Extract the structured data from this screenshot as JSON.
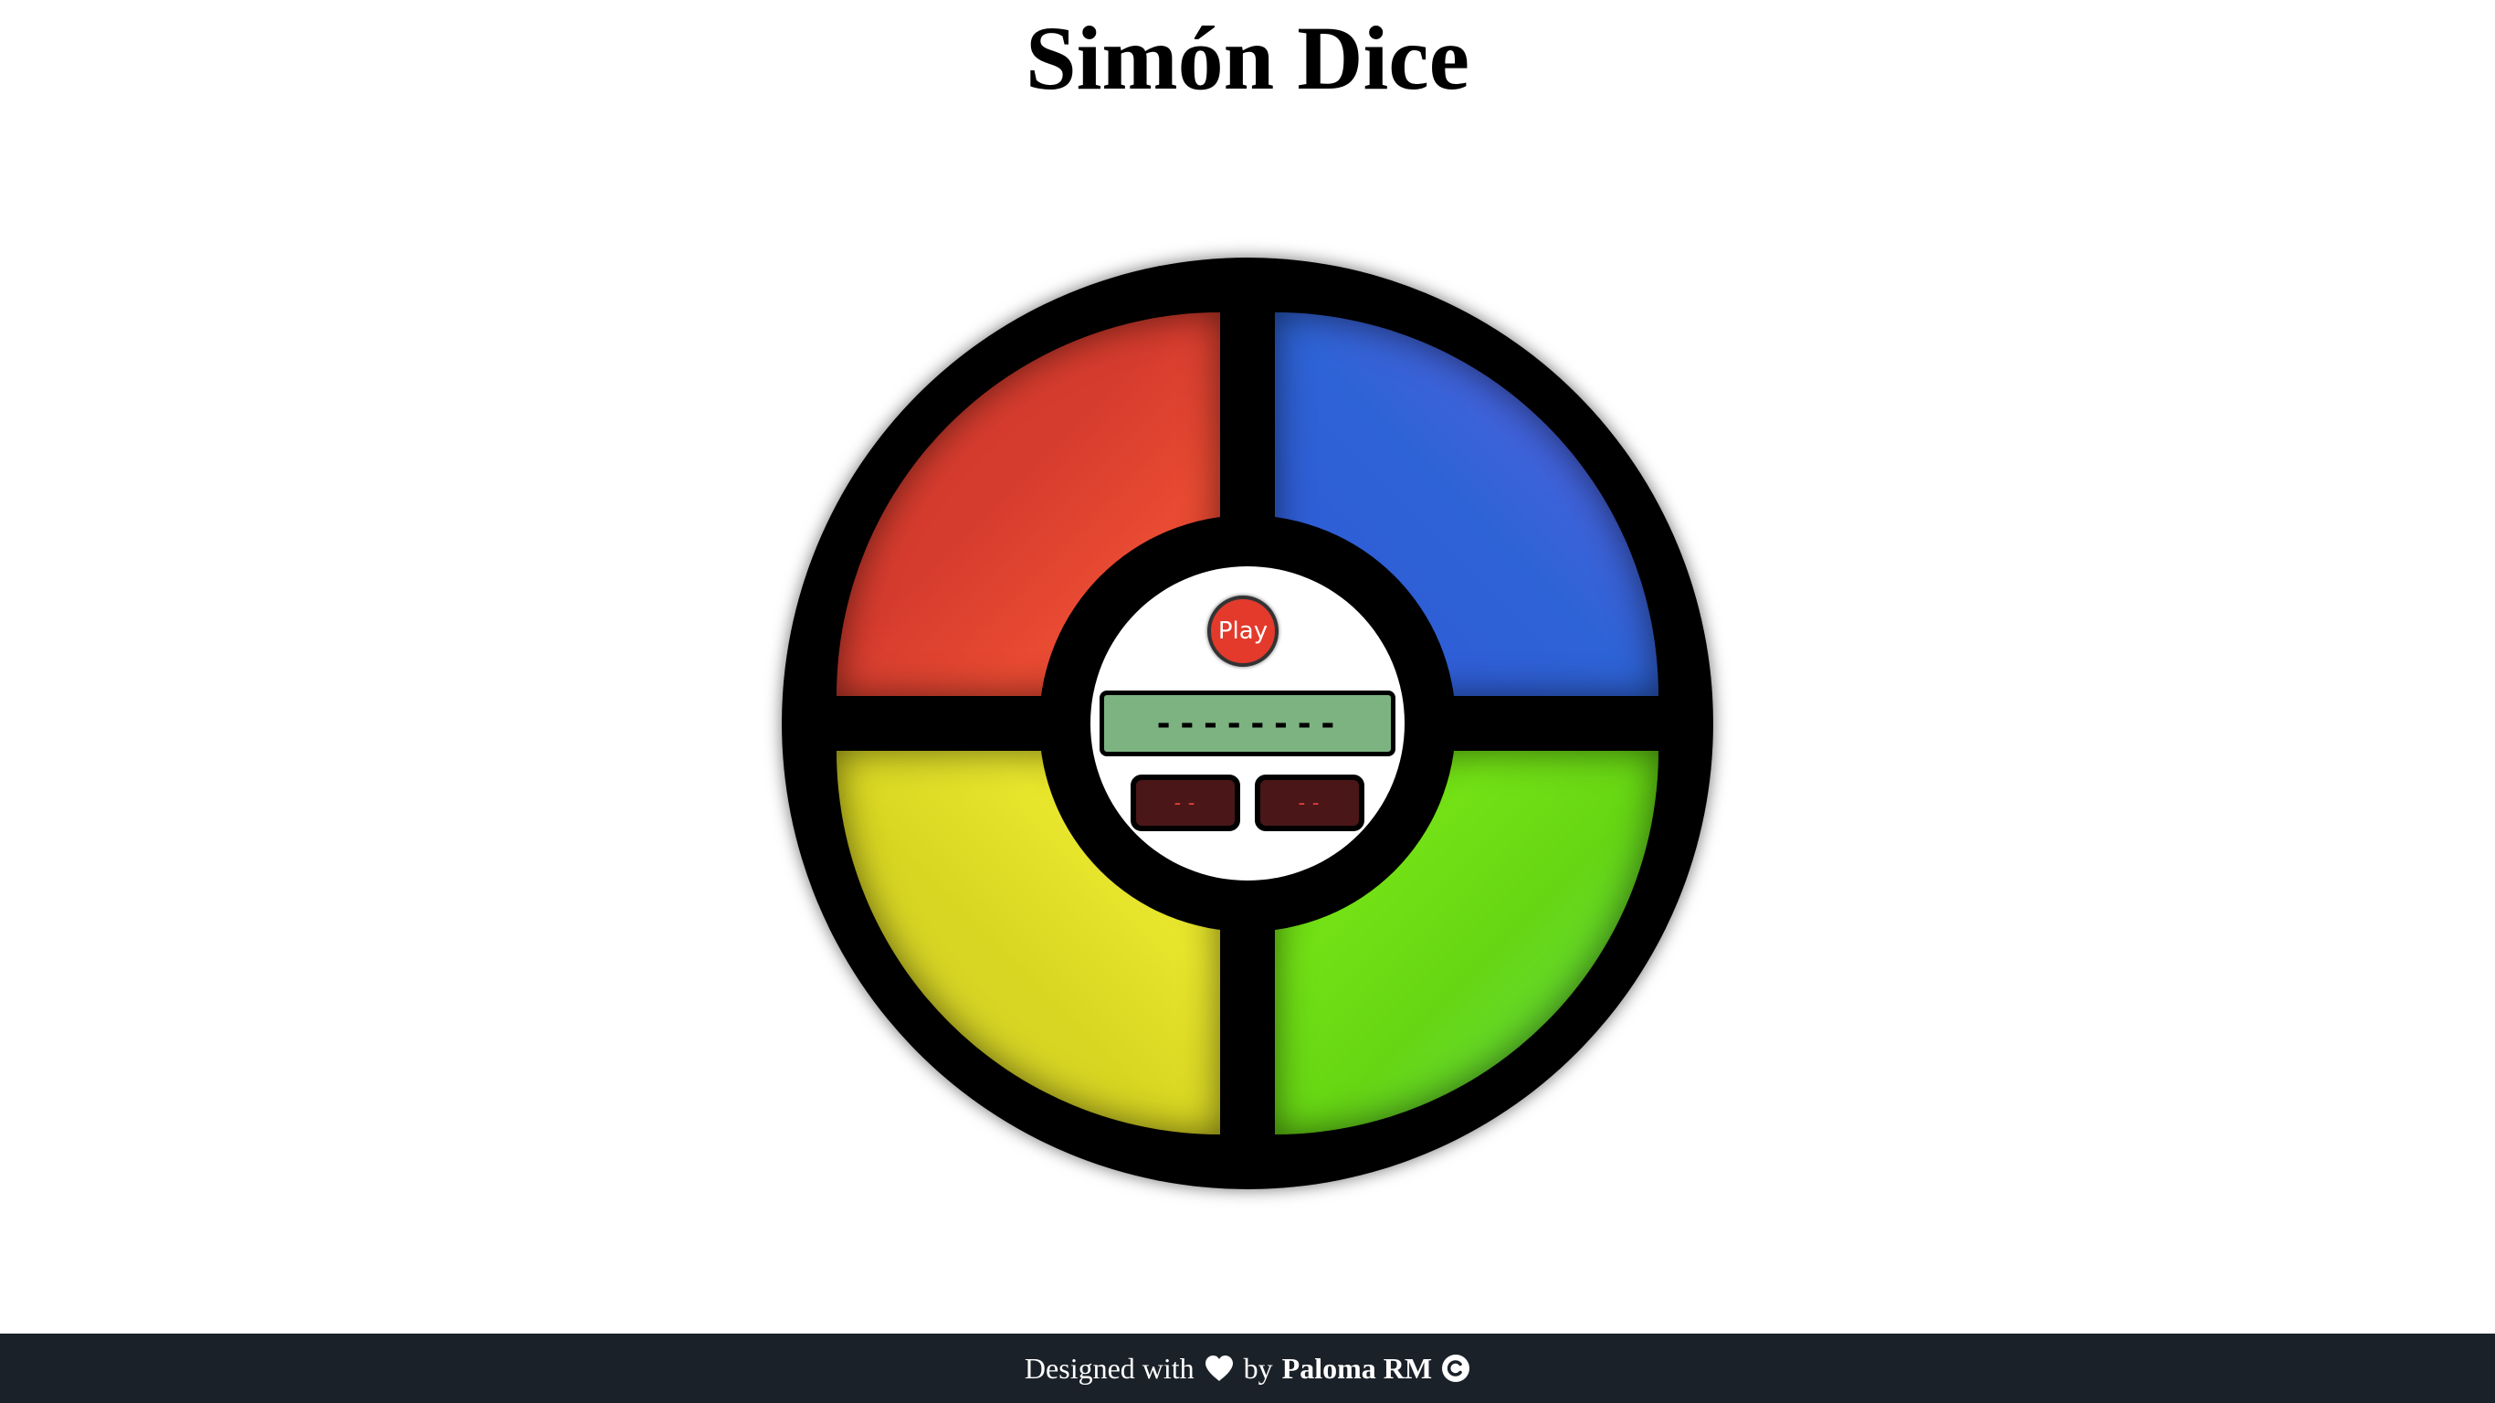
{
  "app": {
    "title": "Simón Dice"
  },
  "board": {
    "pads": [
      {
        "name": "red",
        "color": "#d63c2e"
      },
      {
        "name": "blue",
        "color": "#2e63d6"
      },
      {
        "name": "yellow",
        "color": "#d8d621"
      },
      {
        "name": "green",
        "color": "#66d614"
      }
    ],
    "play_label": "Play",
    "display_text": "--------",
    "counter_left": "--",
    "counter_right": "--"
  },
  "footer": {
    "designed_with": "Designed with",
    "heart_icon": "heart-icon",
    "by": "by",
    "author": "Paloma RM",
    "copyright_icon": "copyright-icon",
    "background": "#1b2128"
  }
}
